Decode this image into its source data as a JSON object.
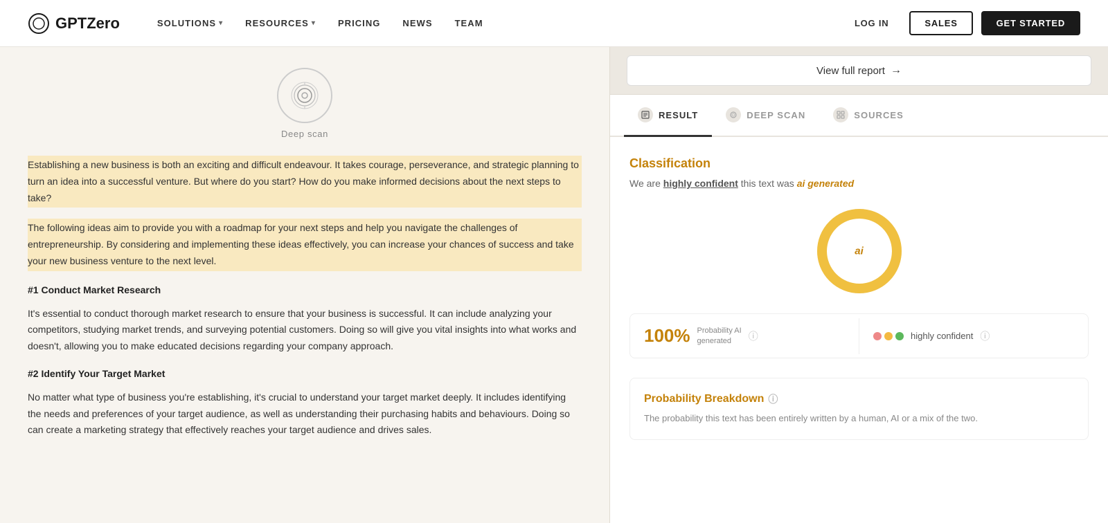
{
  "navbar": {
    "logo_text": "GPTZero",
    "nav_items": [
      {
        "label": "SOLUTIONS",
        "has_dropdown": true
      },
      {
        "label": "RESOURCES",
        "has_dropdown": true
      },
      {
        "label": "PRICING",
        "has_dropdown": false
      },
      {
        "label": "NEWS",
        "has_dropdown": false
      },
      {
        "label": "TEAM",
        "has_dropdown": false
      }
    ],
    "login_label": "LOG IN",
    "sales_label": "SALES",
    "get_started_label": "GET STARTED"
  },
  "left_panel": {
    "deep_scan_label": "Deep scan",
    "paragraphs": [
      {
        "text": "Establishing a new business is both an exciting and difficult endeavour. It takes courage, perseverance, and strategic planning to turn an idea into a successful venture. But where do you start? How do you make informed decisions about the next steps to take?",
        "highlighted": true
      },
      {
        "text": "The following ideas aim to provide you with a roadmap for your next steps and help you navigate the challenges of entrepreneurship. By considering and implementing these ideas effectively, you can increase your chances of success and take your new business venture to the next level.",
        "highlighted": true
      },
      {
        "heading": "#1 Conduct Market Research",
        "text": "It's essential to conduct thorough market research to ensure that your business is successful. It can include analyzing your competitors, studying market trends, and surveying potential customers. Doing so will give you vital insights into what works and doesn't, allowing you to make educated decisions regarding your company approach.",
        "highlighted": false
      },
      {
        "heading": "#2 Identify Your Target Market",
        "text": "No matter what type of business you're establishing, it's crucial to understand your target market deeply. It includes identifying the needs and preferences of your target audience, as well as understanding their purchasing habits and behaviours. Doing so can create a marketing strategy that effectively reaches your target audience and drives sales.",
        "highlighted": false
      }
    ]
  },
  "right_panel": {
    "view_full_report_label": "View full report",
    "arrow": "→",
    "tabs": [
      {
        "label": "RESULT",
        "active": true,
        "icon": "doc"
      },
      {
        "label": "DEEP SCAN",
        "active": false,
        "icon": "fingerprint"
      },
      {
        "label": "SOURCES",
        "active": false,
        "icon": "grid"
      }
    ],
    "result": {
      "classification_title": "Classification",
      "confidence_text_prefix": "We are",
      "confidence_phrase": "highly confident",
      "confidence_text_mid": "this text was",
      "verdict": "ai generated",
      "donut_label": "ai",
      "donut_percentage": 100,
      "stat_percentage": "100%",
      "stat_label_line1": "Probability AI",
      "stat_label_line2": "generated",
      "confidence_level": "highly confident",
      "prob_breakdown_title": "Probability Breakdown",
      "prob_breakdown_desc": "The probability this text has been entirely written by a human, AI or a mix of the two."
    }
  }
}
